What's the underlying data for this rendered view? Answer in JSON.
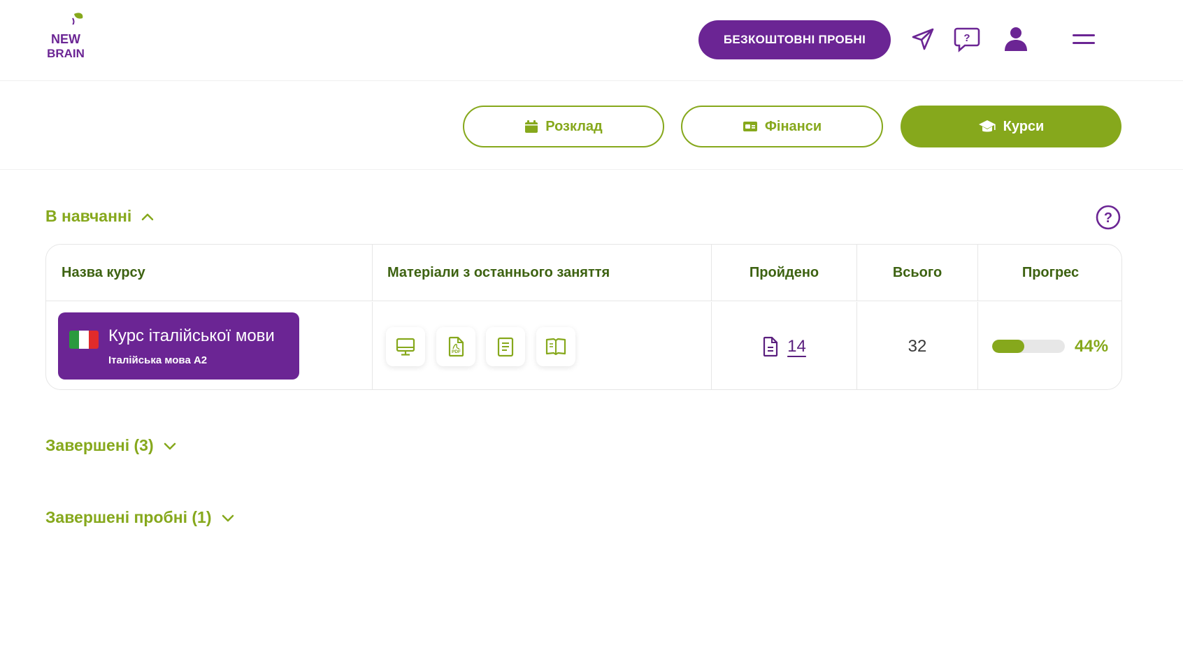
{
  "header": {
    "logo_text": [
      "NEW",
      "BRAIN"
    ],
    "free_trials_label": "БЕЗКОШТОВНІ ПРОБНІ",
    "icons": [
      "send-icon",
      "help-chat-icon",
      "user-icon",
      "menu-icon"
    ]
  },
  "nav": {
    "tabs": [
      {
        "label": "Розклад",
        "icon": "calendar-icon",
        "active": false
      },
      {
        "label": "Фінанси",
        "icon": "wallet-icon",
        "active": false
      },
      {
        "label": "Курси",
        "icon": "graduation-cap-icon",
        "active": true
      }
    ]
  },
  "in_progress": {
    "title": "В навчанні",
    "columns": [
      "Назва курсу",
      "Матеріали з останнього заняття",
      "Пройдено",
      "Всього",
      "Прогрес"
    ],
    "rows": [
      {
        "course_title": "Курс італійської мови",
        "course_subtitle": "Італійська мова А2",
        "flag_colors": [
          "#2a9a3e",
          "#ffffff",
          "#e12b2b"
        ],
        "materials": [
          "presentation-icon",
          "pdf-icon",
          "document-icon",
          "book-icon"
        ],
        "passed": "14",
        "total": "32",
        "progress_label": "44%",
        "progress_fraction": 0.44
      }
    ]
  },
  "completed": {
    "title": "Завершені (3)"
  },
  "completed_trials": {
    "title": "Завершені пробні (1)"
  },
  "colors": {
    "purple": "#6b2594",
    "green": "#86a81c",
    "dark_green": "#3d6211"
  }
}
